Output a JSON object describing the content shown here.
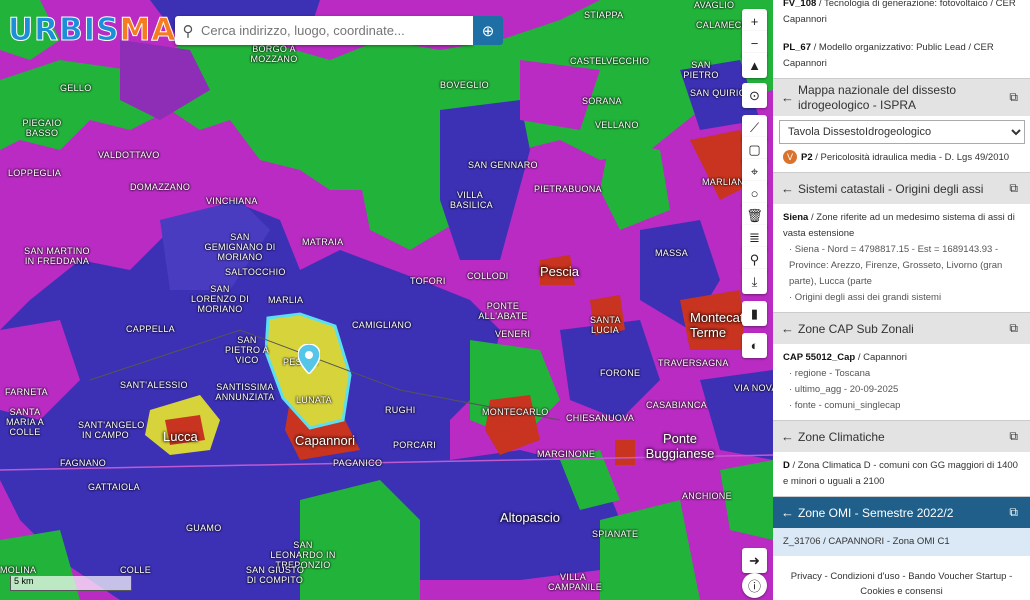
{
  "app": {
    "logo_part1": "URBIS",
    "logo_part2": "MAP"
  },
  "search": {
    "placeholder": "Cerca indirizzo, luogo, coordinate..."
  },
  "map": {
    "places": [
      "BORGO A MOZZANO",
      "GELLO",
      "PIEGAIO BASSO",
      "VALDOTTAVO",
      "LOPPEGLIA",
      "DOMAZZANO",
      "VINCHIANA",
      "SAN GEMIGNANO DI MORIANO",
      "SALTOCCHIO",
      "SAN MARTINO IN FREDDANA",
      "SAN LORENZO DI MORIANO",
      "MARLIA",
      "MATRAIA",
      "CAMIGLIANO",
      "CAPPELLA",
      "SAN PIETRO A VICO",
      "SANTISSIMA ANNUNZIATA",
      "SANT'ALESSIO",
      "FARNETA",
      "SANTA MARIA A COLLE",
      "SANT'ANGELO IN CAMPO",
      "FAGNANO",
      "GATTAIOLA",
      "GUAMO",
      "SAN LEONARDO IN TREPONZIO",
      "SAN GIUSTO DI COMPITO",
      "COLLE",
      "MOLINA",
      "BOVEGLIO",
      "SAN GENNARO",
      "VILLA BASILICA",
      "PIETRABUONA",
      "TOFORI",
      "COLLODI",
      "PONTE ALL'ABATE",
      "VENERI",
      "RUGHI",
      "PORCARI",
      "PAGANICO",
      "MONTECARLO",
      "CHIESANUOVA",
      "MARGINONE",
      "SPIANATE",
      "VILLA CAMPANILE",
      "SORANA",
      "VELLANO",
      "CASTELVECCHIO",
      "STIAPPA",
      "SAN PIETRO",
      "SAN QUIRICO",
      "SANTA LUCIA",
      "TRAVERSAGNA",
      "VIA NOVA",
      "CASABIANCA",
      "FORONE",
      "ANCHIONE",
      "MASSA",
      "MARLIANA",
      "CALAMECCA",
      "AVAGLIO",
      "PESCIA",
      "LUNATA"
    ],
    "towns": {
      "lucca": "Lucca",
      "capannori": "Capannori",
      "pescia": "Pescia",
      "altopascio": "Altopascio",
      "ponte_buggianese": "Ponte Buggianese",
      "montecatini": "Montecatini Terme"
    },
    "scale": "5 km",
    "colors": {
      "magenta": "#b92bc3",
      "purple": "#8e2db6",
      "blue": "#3c30b5",
      "green": "#22b33a",
      "red": "#c8341f",
      "yellow": "#d7d33a"
    }
  },
  "panel": {
    "top_item1_code": "FV_108",
    "top_item1_text": " / Tecnologia di generazione: fotovoltaico / CER Capannori",
    "top_item2_code": "PL_67",
    "top_item2_text": " / Modello organizzativo: Public Lead / CER Capannori",
    "sec_ispra_title": "Mappa nazionale del dissesto idrogeologico - ISPRA",
    "sec_ispra_select": "Tavola DissestoIdrogeologico",
    "sec_ispra_badge": "V",
    "sec_ispra_code": "P2",
    "sec_ispra_text": " / Pericolosità idraulica media - D. Lgs 49/2010",
    "sec_catasto_title": "Sistemi catastali - Origini degli assi",
    "sec_catasto_code": "Siena",
    "sec_catasto_text": " / Zone riferite ad un medesimo sistema di assi di vasta estensione",
    "sec_catasto_sub1": "· Siena - Nord = 4798817.15 - Est = 1689143.93 - Province: Arezzo, Firenze, Grosseto, Livorno (gran parte), Lucca (parte",
    "sec_catasto_sub2": "· Origini degli assi dei grandi sistemi",
    "sec_cap_title": "Zone CAP Sub Zonali",
    "sec_cap_code": "CAP 55012_Cap",
    "sec_cap_text": " / Capannori",
    "sec_cap_sub1": "· regione - Toscana",
    "sec_cap_sub2": "· ultimo_agg - 20-09-2025",
    "sec_cap_sub3": "· fonte - comuni_singlecap",
    "sec_clima_title": "Zone Climatiche",
    "sec_clima_code": "D",
    "sec_clima_text": " / Zona Climatica D - comuni con GG maggiori di 1400 e minori o uguali a 2100",
    "sec_omi_title": "Zone OMI - Semestre 2022/2",
    "sec_omi_peek": "Z_31706 / CAPANNORI - Zona OMI C1"
  },
  "footer": {
    "line1": "Privacy - Condizioni d'uso - Bando Voucher Startup -",
    "line2": "Cookies e consensi"
  }
}
